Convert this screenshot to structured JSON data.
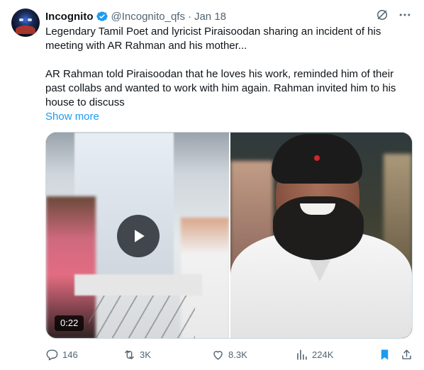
{
  "author": {
    "display_name": "Incognito",
    "handle": "@Incognito_qfs",
    "separator": "·",
    "date": "Jan 18",
    "verified_color": "#1d9bf0"
  },
  "icons": {
    "verified": "verified-badge-icon",
    "grok": "grok-icon",
    "more": "more-horizontal-icon",
    "play": "play-icon",
    "reply": "reply-icon",
    "repost": "repost-icon",
    "like": "heart-icon",
    "views": "views-icon",
    "bookmark": "bookmark-icon",
    "share": "share-icon"
  },
  "tweet": {
    "paragraph1": "Legendary Tamil Poet and lyricist Piraisoodan sharing an incident of his meeting with AR Rahman and his mother...",
    "paragraph2": "AR Rahman told Piraisoodan that he loves his work, reminded him of their past collabs and wanted to work with him again. Rahman invited him to his house to discuss",
    "show_more": "Show more"
  },
  "media": {
    "video_duration": "0:22"
  },
  "actions": {
    "replies": "146",
    "reposts": "3K",
    "likes": "8.3K",
    "views": "224K",
    "bookmark_color": "#1d9bf0"
  }
}
